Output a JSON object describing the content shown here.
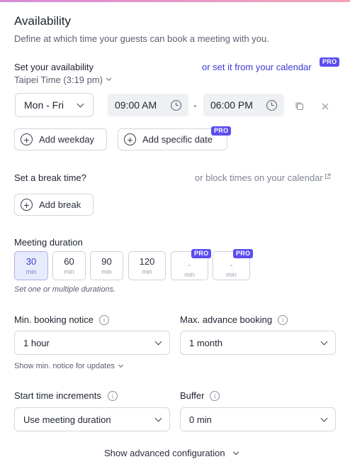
{
  "header": {
    "title": "Availability",
    "subtitle": "Define at which time your guests can book a meeting with you."
  },
  "availability": {
    "label": "Set your availability",
    "calendar_link": "or set it from your calendar",
    "pro_badge": "PRO",
    "timezone": "Taipei Time (3:19 pm)",
    "day_range": "Mon - Fri",
    "start_time": "09:00 AM",
    "separator": "-",
    "end_time": "06:00 PM",
    "add_weekday": "Add weekday",
    "add_specific_date": "Add specific date"
  },
  "break": {
    "label": "Set a break time?",
    "block_link": "or block times on your calendar",
    "add_break": "Add break"
  },
  "duration": {
    "label": "Meeting duration",
    "options": [
      {
        "value": "30",
        "unit": "min",
        "selected": true,
        "pro": false
      },
      {
        "value": "60",
        "unit": "min",
        "selected": false,
        "pro": false
      },
      {
        "value": "90",
        "unit": "min",
        "selected": false,
        "pro": false
      },
      {
        "value": "120",
        "unit": "min",
        "selected": false,
        "pro": false
      },
      {
        "value": "-",
        "unit": "min",
        "selected": false,
        "pro": true
      },
      {
        "value": "-",
        "unit": "min",
        "selected": false,
        "pro": true
      }
    ],
    "hint": "Set one or multiple durations."
  },
  "booking": {
    "min_notice_label": "Min. booking notice",
    "min_notice_value": "1 hour",
    "max_advance_label": "Max. advance booking",
    "max_advance_value": "1 month",
    "show_min_notice_link": "Show min. notice for updates"
  },
  "increments": {
    "label": "Start time increments",
    "value": "Use meeting duration",
    "buffer_label": "Buffer",
    "buffer_value": "0 min"
  },
  "footer": {
    "advanced_link": "Show advanced configuration"
  },
  "colors": {
    "accent": "#3d3ad6",
    "pro_badge": "#5b4df0",
    "selected_bg": "#e7ebfb"
  }
}
